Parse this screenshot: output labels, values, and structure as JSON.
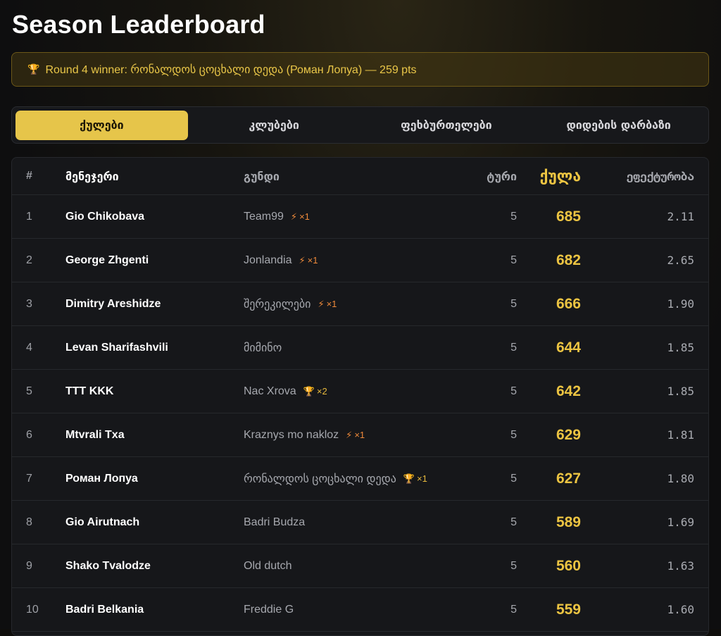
{
  "page": {
    "title": "Season Leaderboard"
  },
  "banner": {
    "icon": "trophy-icon",
    "text": "Round 4 winner: რონალდოს ცოცხალი დედა (Роман Лопуа) — 259 pts"
  },
  "tabs": [
    {
      "label": "ქულები",
      "active": true
    },
    {
      "label": "კლუბები",
      "active": false
    },
    {
      "label": "ფეხბურთელები",
      "active": false
    },
    {
      "label": "დიდების დარბაზი",
      "active": false
    }
  ],
  "table": {
    "headers": {
      "rank": "#",
      "manager": "მენეჯერი",
      "team": "გუნდი",
      "rounds": "ტური",
      "points": "ქულა",
      "efficiency": "ეფექტურობა"
    },
    "rows": [
      {
        "rank": "1",
        "manager": "Gio Chikobava",
        "team": "Team99",
        "badge": "bolt",
        "badge_count": "×1",
        "rounds": "5",
        "points": "685",
        "efficiency": "2.11"
      },
      {
        "rank": "2",
        "manager": "George Zhgenti",
        "team": "Jonlandia",
        "badge": "bolt",
        "badge_count": "×1",
        "rounds": "5",
        "points": "682",
        "efficiency": "2.65"
      },
      {
        "rank": "3",
        "manager": "Dimitry Areshidze",
        "team": "შერეკილები",
        "badge": "bolt",
        "badge_count": "×1",
        "rounds": "5",
        "points": "666",
        "efficiency": "1.90"
      },
      {
        "rank": "4",
        "manager": "Levan Sharifashvili",
        "team": "მიმინო",
        "badge": "",
        "badge_count": "",
        "rounds": "5",
        "points": "644",
        "efficiency": "1.85"
      },
      {
        "rank": "5",
        "manager": "TTT KKK",
        "team": "Nac Xrova",
        "badge": "trophy",
        "badge_count": "×2",
        "rounds": "5",
        "points": "642",
        "efficiency": "1.85"
      },
      {
        "rank": "6",
        "manager": "Mtvrali Txa",
        "team": "Kraznys mo nakloz",
        "badge": "bolt",
        "badge_count": "×1",
        "rounds": "5",
        "points": "629",
        "efficiency": "1.81"
      },
      {
        "rank": "7",
        "manager": "Роман Лопуа",
        "team": "რონალდოს ცოცხალი დედა",
        "badge": "trophy",
        "badge_count": "×1",
        "rounds": "5",
        "points": "627",
        "efficiency": "1.80"
      },
      {
        "rank": "8",
        "manager": "Gio Airutnach",
        "team": "Badri Budza",
        "badge": "",
        "badge_count": "",
        "rounds": "5",
        "points": "589",
        "efficiency": "1.69"
      },
      {
        "rank": "9",
        "manager": "Shako Tvalodze",
        "team": "Old dutch",
        "badge": "",
        "badge_count": "",
        "rounds": "5",
        "points": "560",
        "efficiency": "1.63"
      },
      {
        "rank": "10",
        "manager": "Badri Belkania",
        "team": "Freddie G",
        "badge": "",
        "badge_count": "",
        "rounds": "5",
        "points": "559",
        "efficiency": "1.60"
      }
    ]
  },
  "colors": {
    "accent": "#e6c54a",
    "points": "#ecc442",
    "bolt": "#ef8a3a",
    "trophy": "#e6b93d"
  }
}
